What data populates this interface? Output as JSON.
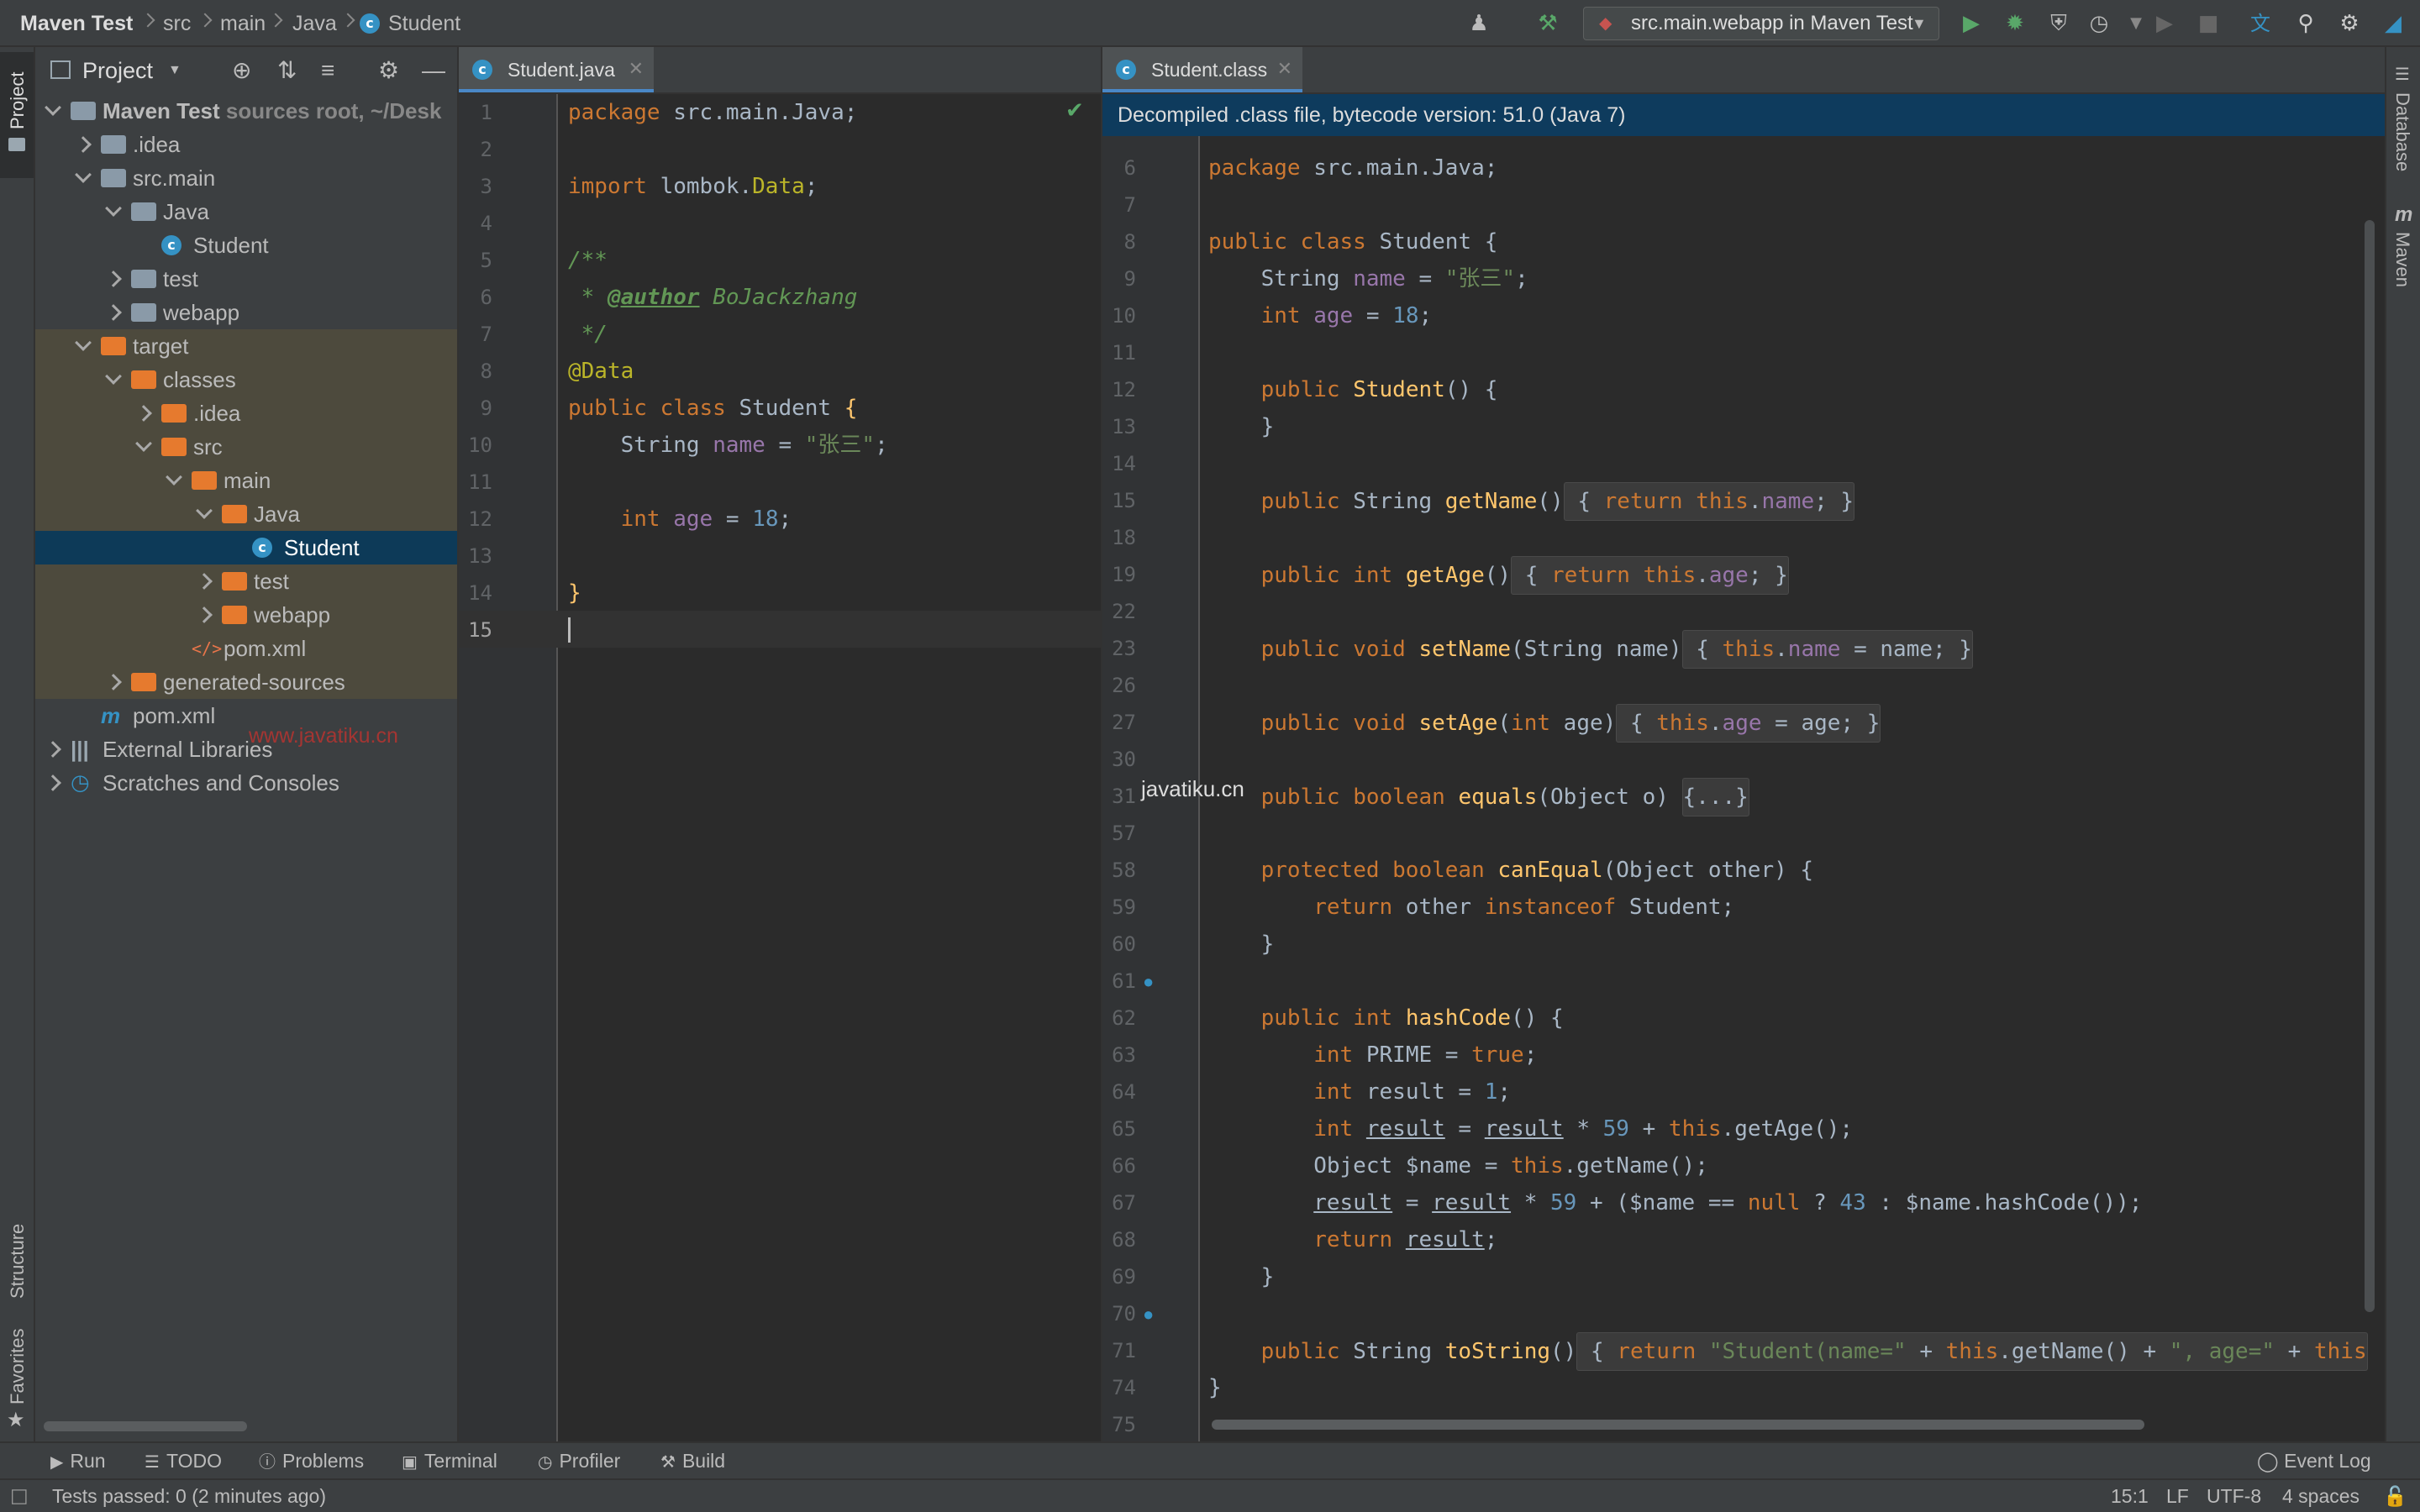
{
  "breadcrumb": {
    "project": "Maven Test",
    "items": [
      "src",
      "main",
      "Java",
      "Student"
    ]
  },
  "toolbar": {
    "run_config": "src.main.webapp in Maven Test",
    "icons": [
      "user-icon",
      "build-hammer-icon",
      "run-icon",
      "debug-icon",
      "coverage-icon",
      "profile-icon",
      "translate-icon",
      "search-icon",
      "settings-icon"
    ]
  },
  "left_strip": {
    "project": "Project",
    "structure": "Structure",
    "favorites": "Favorites"
  },
  "right_strip": {
    "database": "Database",
    "maven": "Maven"
  },
  "project_panel": {
    "title": "Project",
    "tree": [
      {
        "label": "Maven Test",
        "suffix": " sources root, ~/Desk",
        "depth": 0,
        "state": "open",
        "icon": "module",
        "bold": true
      },
      {
        "label": ".idea",
        "depth": 1,
        "state": "closed",
        "icon": "folder-grey"
      },
      {
        "label": "src.main",
        "depth": 1,
        "state": "open",
        "icon": "folder-grey"
      },
      {
        "label": "Java",
        "depth": 2,
        "state": "open",
        "icon": "folder-grey"
      },
      {
        "label": "Student",
        "depth": 3,
        "state": "none",
        "icon": "class"
      },
      {
        "label": "test",
        "depth": 2,
        "state": "closed",
        "icon": "folder-grey"
      },
      {
        "label": "webapp",
        "depth": 2,
        "state": "closed",
        "icon": "folder-web"
      },
      {
        "label": "target",
        "depth": 1,
        "state": "open",
        "icon": "folder-orange",
        "excluded": true
      },
      {
        "label": "classes",
        "depth": 2,
        "state": "open",
        "icon": "folder-orange",
        "excluded": true
      },
      {
        "label": ".idea",
        "depth": 3,
        "state": "closed",
        "icon": "folder-orange",
        "excluded": true
      },
      {
        "label": "src",
        "depth": 3,
        "state": "open",
        "icon": "folder-orange",
        "excluded": true
      },
      {
        "label": "main",
        "depth": 4,
        "state": "open",
        "icon": "folder-orange",
        "excluded": true
      },
      {
        "label": "Java",
        "depth": 5,
        "state": "open",
        "icon": "folder-orange",
        "excluded": true
      },
      {
        "label": "Student",
        "depth": 6,
        "state": "none",
        "icon": "class",
        "selected": true
      },
      {
        "label": "test",
        "depth": 5,
        "state": "closed",
        "icon": "folder-orange",
        "excluded": true
      },
      {
        "label": "webapp",
        "depth": 5,
        "state": "closed",
        "icon": "folder-orange",
        "excluded": true
      },
      {
        "label": "pom.xml",
        "depth": 4,
        "state": "none",
        "icon": "xml",
        "excluded": true
      },
      {
        "label": "generated-sources",
        "depth": 2,
        "state": "closed",
        "icon": "folder-orange",
        "excluded": true
      },
      {
        "label": "pom.xml",
        "depth": 1,
        "state": "none",
        "icon": "maven"
      },
      {
        "label": "External Libraries",
        "depth": 0,
        "state": "closed",
        "icon": "library"
      },
      {
        "label": "Scratches and Consoles",
        "depth": 0,
        "state": "closed",
        "icon": "scratch"
      }
    ],
    "watermark": "www.javatiku.cn"
  },
  "editor1": {
    "tab": "Student.java",
    "lines": [
      {
        "n": "1",
        "html": "<span class='kw'>package</span> src.main.Java;"
      },
      {
        "n": "2",
        "html": ""
      },
      {
        "n": "3",
        "html": "<span class='kw'>import</span> lombok.<span class='ann'>Data</span>;"
      },
      {
        "n": "4",
        "html": ""
      },
      {
        "n": "5",
        "html": "<span class='cmt'>/**</span>"
      },
      {
        "n": "6",
        "html": "<span class='cmt'> * </span><span class='tag cmt'>@author</span><span class='cmt'> BoJackzhang</span>"
      },
      {
        "n": "7",
        "html": "<span class='cmt'> */</span>"
      },
      {
        "n": "8",
        "html": "<span class='ann'>@Data</span>"
      },
      {
        "n": "9",
        "html": "<span class='kw'>public class</span> Student <span class='fn'>{</span>"
      },
      {
        "n": "10",
        "html": "    String <span class='fld'>name</span> = <span class='str'>\"张三\"</span>;"
      },
      {
        "n": "11",
        "html": ""
      },
      {
        "n": "12",
        "html": "    <span class='kw'>int</span> <span class='fld'>age</span> = <span class='num'>18</span>;"
      },
      {
        "n": "13",
        "html": ""
      },
      {
        "n": "14",
        "html": "<span class='fn'>}</span>"
      },
      {
        "n": "15",
        "html": ""
      }
    ]
  },
  "editor2": {
    "tab": "Student.class",
    "banner": "Decompiled .class file, bytecode version: 51.0 (Java 7)",
    "watermark": "javatiku.cn",
    "lines": [
      {
        "n": "6",
        "html": "<span class='kw'>package</span> src.main.Java;"
      },
      {
        "n": "7",
        "html": ""
      },
      {
        "n": "8",
        "html": "<span class='kw'>public class</span> Student {"
      },
      {
        "n": "9",
        "html": "    String <span class='fld'>name</span> = <span class='str'>\"张三\"</span>;"
      },
      {
        "n": "10",
        "html": "    <span class='kw'>int</span> <span class='fld'>age</span> = <span class='num'>18</span>;"
      },
      {
        "n": "11",
        "html": ""
      },
      {
        "n": "12",
        "html": "    <span class='kw'>public</span> <span class='fn'>Student</span>() {"
      },
      {
        "n": "13",
        "html": "    }"
      },
      {
        "n": "14",
        "html": ""
      },
      {
        "n": "15",
        "html": "    <span class='kw'>public</span> String <span class='fn'>getName</span>()<span class='fold'> { <span class='kw'>return this</span>.<span class='fld'>name</span>; }</span>"
      },
      {
        "n": "18",
        "html": ""
      },
      {
        "n": "19",
        "html": "    <span class='kw'>public int</span> <span class='fn'>getAge</span>()<span class='fold'> { <span class='kw'>return this</span>.<span class='fld'>age</span>; }</span>"
      },
      {
        "n": "22",
        "html": ""
      },
      {
        "n": "23",
        "html": "    <span class='kw'>public void</span> <span class='fn'>setName</span>(String name)<span class='fold'> { <span class='kw'>this</span>.<span class='fld'>name</span> = name; }</span>"
      },
      {
        "n": "26",
        "html": ""
      },
      {
        "n": "27",
        "html": "    <span class='kw'>public void</span> <span class='fn'>setAge</span>(<span class='kw'>int</span> age)<span class='fold'> { <span class='kw'>this</span>.<span class='fld'>age</span> = age; }</span>"
      },
      {
        "n": "30",
        "html": ""
      },
      {
        "n": "31",
        "html": "    <span class='kw'>public boolean</span> <span class='fn'>equals</span>(Object o) <span class='fold'>{...}</span>"
      },
      {
        "n": "57",
        "html": ""
      },
      {
        "n": "58",
        "html": "    <span class='kw'>protected boolean</span> <span class='fn'>canEqual</span>(Object other) {"
      },
      {
        "n": "59",
        "html": "        <span class='kw'>return</span> other <span class='kw'>instanceof</span> Student;"
      },
      {
        "n": "60",
        "html": "    }"
      },
      {
        "n": "61",
        "html": ""
      },
      {
        "n": "62",
        "html": "    <span class='kw'>public int</span> <span class='fn'>hashCode</span>() {"
      },
      {
        "n": "63",
        "html": "        <span class='kw'>int</span> PRIME = <span class='kw'>true</span>;"
      },
      {
        "n": "64",
        "html": "        <span class='kw'>int</span> result = <span class='num'>1</span>;"
      },
      {
        "n": "65",
        "html": "        <span class='kw'>int</span> <u>result</u> = <u>result</u> * <span class='num'>59</span> + <span class='kw'>this</span>.getAge();"
      },
      {
        "n": "66",
        "html": "        Object $name = <span class='kw'>this</span>.getName();"
      },
      {
        "n": "67",
        "html": "        <u>result</u> = <u>result</u> * <span class='num'>59</span> + ($name == <span class='kw'>null</span> ? <span class='num'>43</span> : $name.hashCode());"
      },
      {
        "n": "68",
        "html": "        <span class='kw'>return</span> <u>result</u>;"
      },
      {
        "n": "69",
        "html": "    }"
      },
      {
        "n": "70",
        "html": ""
      },
      {
        "n": "71",
        "html": "    <span class='kw'>public</span> String <span class='fn'>toString</span>()<span class='fold'> { <span class='kw'>return</span> <span class='str'>\"Student(name=\"</span> + <span class='kw'>this</span>.getName() + <span class='str'>\", age=\"</span> + <span class='kw'>this</span></span>"
      },
      {
        "n": "74",
        "html": "}"
      },
      {
        "n": "75",
        "html": ""
      }
    ]
  },
  "tool_windows": [
    {
      "label": "Run",
      "icon": "play-icon"
    },
    {
      "label": "TODO",
      "icon": "list-icon"
    },
    {
      "label": "Problems",
      "icon": "info-icon"
    },
    {
      "label": "Terminal",
      "icon": "terminal-icon"
    },
    {
      "label": "Profiler",
      "icon": "profiler-icon"
    },
    {
      "label": "Build",
      "icon": "hammer-icon"
    }
  ],
  "event_log": "Event Log",
  "status": {
    "message": "Tests passed: 0 (2 minutes ago)",
    "position": "15:1",
    "line_sep": "LF",
    "encoding": "UTF-8",
    "indent": "4 spaces"
  },
  "colors": {
    "accent": "#4a88c7",
    "selection": "#0d3a58",
    "banner": "#0e3b5d",
    "excluded": "#4d4a3d"
  }
}
